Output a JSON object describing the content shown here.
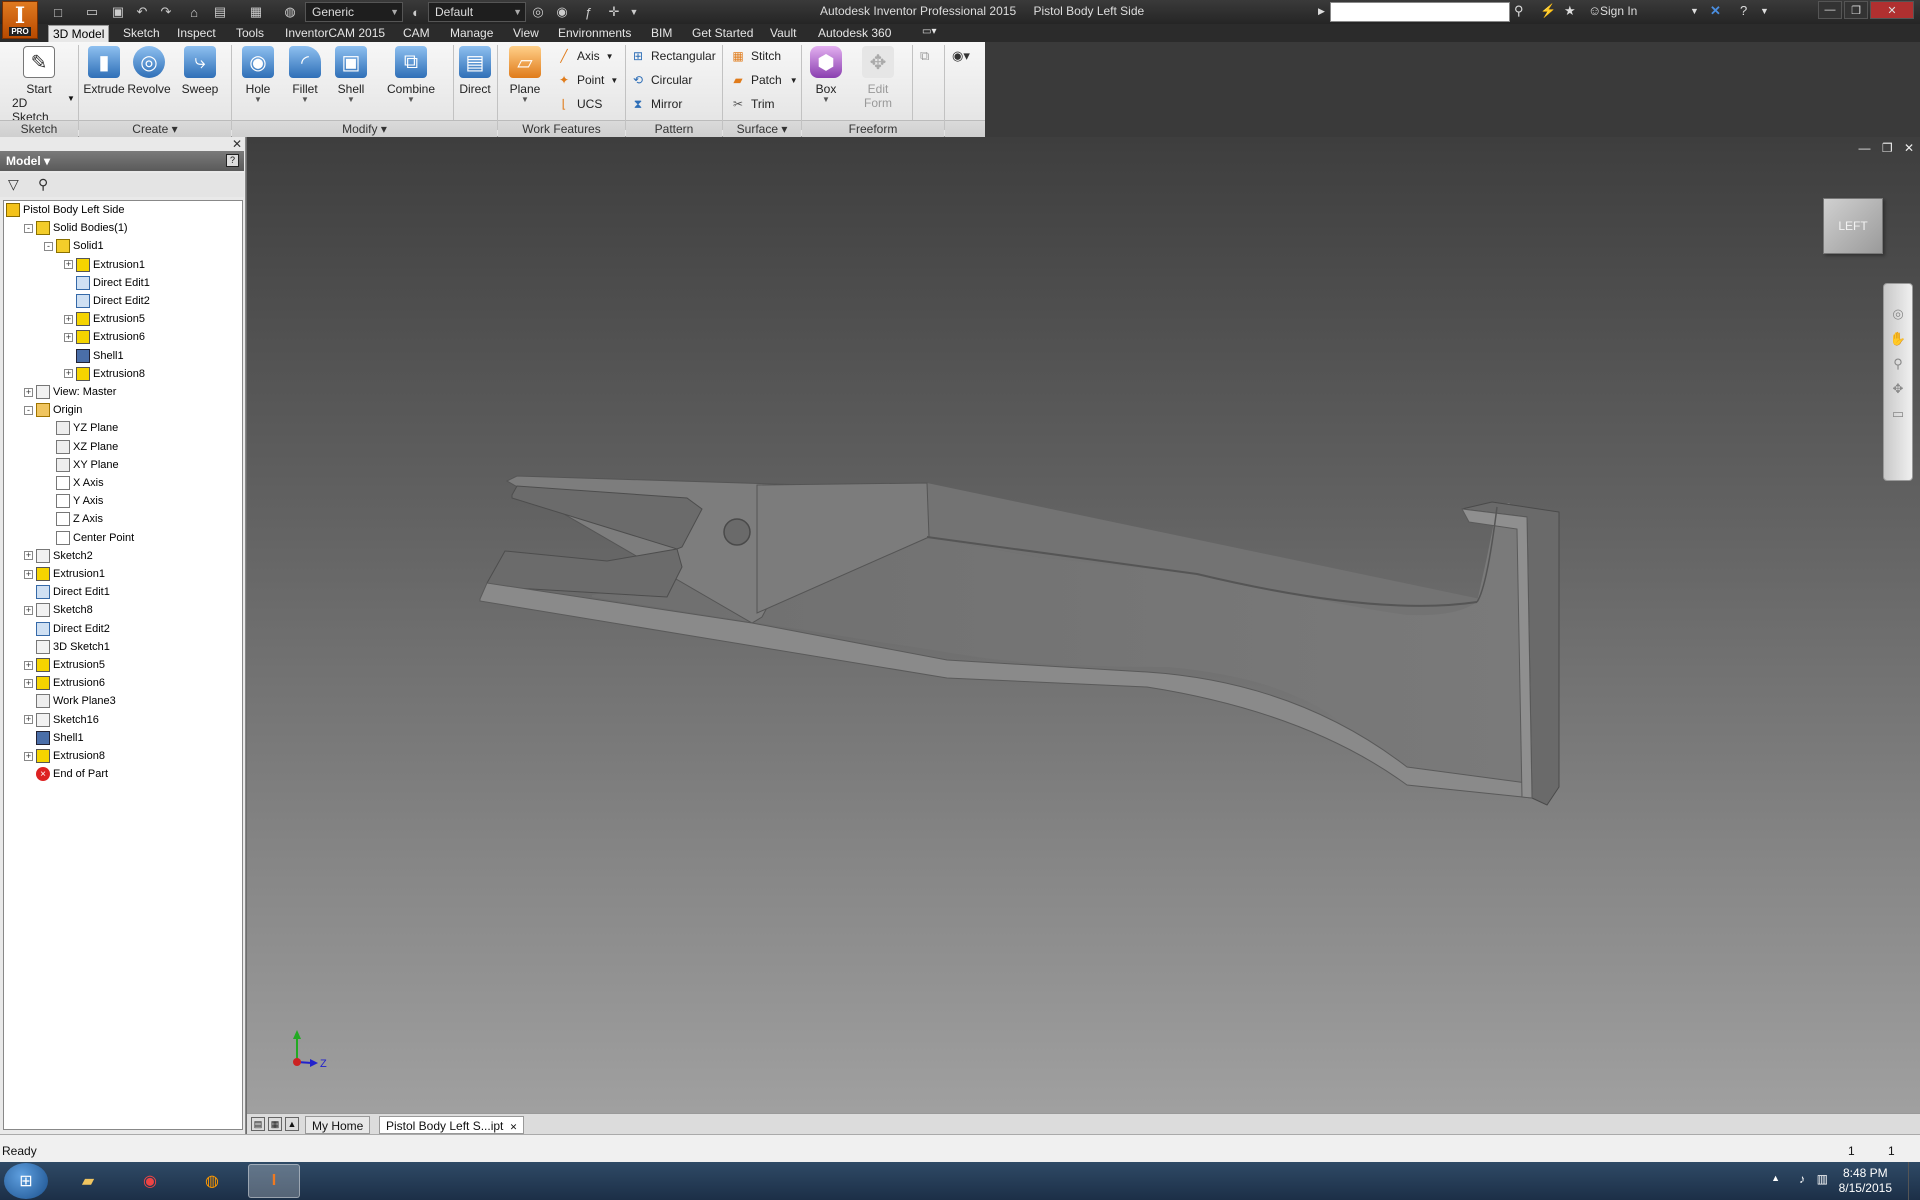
{
  "titlebar": {
    "app_letter": "I",
    "app_badge": "PRO",
    "material": "Generic",
    "appearance": "Default",
    "app_name": "Autodesk Inventor Professional 2015",
    "doc_name": "Pistol Body Left Side",
    "sign_in": "Sign In"
  },
  "menu": {
    "tabs": [
      "3D Model",
      "Sketch",
      "Inspect",
      "Tools",
      "InventorCAM 2015",
      "CAM",
      "Manage",
      "View",
      "Environments",
      "BIM",
      "Get Started",
      "Vault",
      "Autodesk 360"
    ],
    "active": "3D Model"
  },
  "ribbon": {
    "start_sketch_1": "Start",
    "start_sketch_2": "2D Sketch",
    "extrude": "Extrude",
    "revolve": "Revolve",
    "sweep": "Sweep",
    "hole": "Hole",
    "fillet": "Fillet",
    "shell": "Shell",
    "combine": "Combine",
    "direct": "Direct",
    "plane": "Plane",
    "axis": "Axis",
    "point": "Point",
    "ucs": "UCS",
    "rectangular": "Rectangular",
    "circular": "Circular",
    "mirror": "Mirror",
    "stitch": "Stitch",
    "patch": "Patch",
    "trim": "Trim",
    "box": "Box",
    "edit_form_1": "Edit",
    "edit_form_2": "Form",
    "panels": {
      "sketch": "Sketch",
      "create": "Create",
      "modify": "Modify",
      "work_features": "Work Features",
      "pattern": "Pattern",
      "surface": "Surface",
      "freeform": "Freeform"
    }
  },
  "browser": {
    "title": "Model",
    "tree": [
      {
        "label": "Pistol Body Left Side",
        "icon": "part-icon",
        "exp": ""
      },
      {
        "label": "Solid Bodies(1)",
        "icon": "solid-bodies-icon",
        "exp": "-"
      },
      {
        "label": "Solid1",
        "icon": "solid-icon",
        "exp": "-"
      },
      {
        "label": "Extrusion1",
        "icon": "extrusion-icon",
        "exp": "+"
      },
      {
        "label": "Direct Edit1",
        "icon": "direct-edit-icon",
        "exp": ""
      },
      {
        "label": "Direct Edit2",
        "icon": "direct-edit-icon",
        "exp": ""
      },
      {
        "label": "Extrusion5",
        "icon": "extrusion-icon",
        "exp": "+"
      },
      {
        "label": "Extrusion6",
        "icon": "extrusion-icon",
        "exp": "+"
      },
      {
        "label": "Shell1",
        "icon": "shell-icon",
        "exp": ""
      },
      {
        "label": "Extrusion8",
        "icon": "extrusion-icon",
        "exp": "+"
      },
      {
        "label": "View: Master",
        "icon": "view-icon",
        "exp": "+"
      },
      {
        "label": "Origin",
        "icon": "folder-icon",
        "exp": "-"
      },
      {
        "label": "YZ Plane",
        "icon": "plane-icon",
        "exp": ""
      },
      {
        "label": "XZ Plane",
        "icon": "plane-icon",
        "exp": ""
      },
      {
        "label": "XY Plane",
        "icon": "plane-icon",
        "exp": ""
      },
      {
        "label": "X Axis",
        "icon": "axis-icon",
        "exp": ""
      },
      {
        "label": "Y Axis",
        "icon": "axis-icon",
        "exp": ""
      },
      {
        "label": "Z Axis",
        "icon": "axis-icon",
        "exp": ""
      },
      {
        "label": "Center Point",
        "icon": "point-icon",
        "exp": ""
      },
      {
        "label": "Sketch2",
        "icon": "sketch-icon",
        "exp": "+"
      },
      {
        "label": "Extrusion1",
        "icon": "extrusion-icon",
        "exp": "+"
      },
      {
        "label": "Direct Edit1",
        "icon": "direct-edit-icon",
        "exp": ""
      },
      {
        "label": "Sketch8",
        "icon": "sketch-icon",
        "exp": "+"
      },
      {
        "label": "Direct Edit2",
        "icon": "direct-edit-icon",
        "exp": ""
      },
      {
        "label": "3D Sketch1",
        "icon": "3d-sketch-icon",
        "exp": ""
      },
      {
        "label": "Extrusion5",
        "icon": "extrusion-icon",
        "exp": "+"
      },
      {
        "label": "Extrusion6",
        "icon": "extrusion-icon",
        "exp": "+"
      },
      {
        "label": "Work Plane3",
        "icon": "plane-icon",
        "exp": ""
      },
      {
        "label": "Sketch16",
        "icon": "sketch-icon",
        "exp": "+"
      },
      {
        "label": "Shell1",
        "icon": "shell-icon",
        "exp": ""
      },
      {
        "label": "Extrusion8",
        "icon": "extrusion-icon",
        "exp": "+"
      },
      {
        "label": "End of Part",
        "icon": "end-of-part-icon",
        "exp": ""
      }
    ]
  },
  "viewport": {
    "viewcube_label": "LEFT",
    "triad_z": "Z"
  },
  "doc_tabs": {
    "home": "My Home",
    "active": "Pistol Body Left S...ipt"
  },
  "status": {
    "text": "Ready",
    "num1": "1",
    "num2": "1"
  },
  "taskbar": {
    "time": "8:48 PM",
    "date": "8/15/2015"
  }
}
